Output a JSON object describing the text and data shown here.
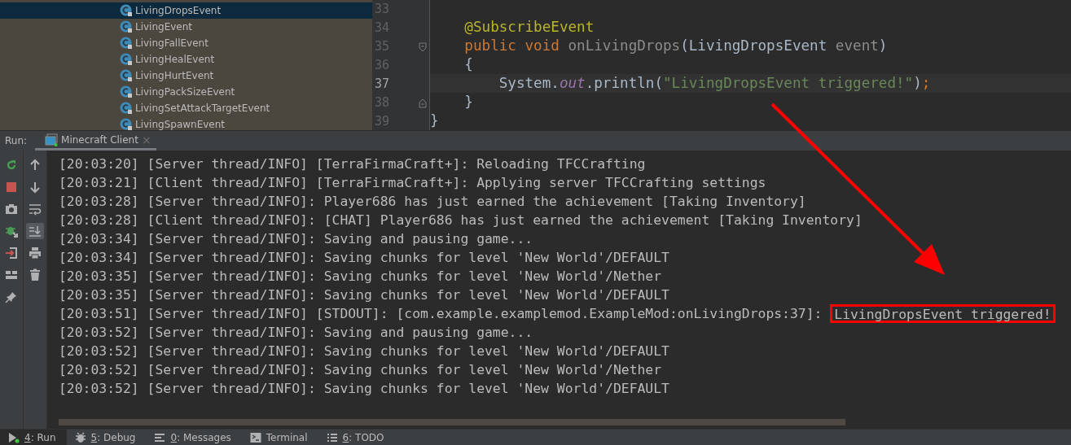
{
  "project_tree": {
    "items": [
      {
        "label": "LivingDropsEvent",
        "selected": true
      },
      {
        "label": "LivingEvent",
        "selected": false
      },
      {
        "label": "LivingFallEvent",
        "selected": false
      },
      {
        "label": "LivingHealEvent",
        "selected": false
      },
      {
        "label": "LivingHurtEvent",
        "selected": false
      },
      {
        "label": "LivingPackSizeEvent",
        "selected": false
      },
      {
        "label": "LivingSetAttackTargetEvent",
        "selected": false
      },
      {
        "label": "LivingSpawnEvent",
        "selected": false
      }
    ]
  },
  "editor": {
    "lines": [
      {
        "number": "33",
        "current": false
      },
      {
        "number": "34",
        "current": false,
        "tokens": [
          {
            "kind": "annotation",
            "text": "    @SubscribeEvent"
          }
        ]
      },
      {
        "number": "35",
        "current": false,
        "fold_start": true,
        "tokens": [
          {
            "kind": "keyword",
            "text": "    public void "
          },
          {
            "kind": "unused",
            "text": "onLivingDrops"
          },
          {
            "kind": "plain",
            "text": "(LivingDropsEvent "
          },
          {
            "kind": "unused",
            "text": "event"
          },
          {
            "kind": "plain",
            "text": ")"
          }
        ]
      },
      {
        "number": "36",
        "current": false,
        "tokens": [
          {
            "kind": "plain",
            "text": "    {"
          }
        ]
      },
      {
        "number": "37",
        "current": true,
        "tokens": [
          {
            "kind": "plain",
            "text": "        System."
          },
          {
            "kind": "static",
            "text": "out"
          },
          {
            "kind": "plain",
            "text": ".println("
          },
          {
            "kind": "string",
            "text": "\"LivingDropsEvent triggered!\""
          },
          {
            "kind": "plain",
            "text": ")"
          },
          {
            "kind": "keyword",
            "text": ";"
          }
        ]
      },
      {
        "number": "38",
        "current": false,
        "fold_end": true,
        "tokens": [
          {
            "kind": "plain",
            "text": "    }"
          }
        ]
      },
      {
        "number": "39",
        "current": false,
        "tokens": [
          {
            "kind": "plain",
            "text": "}"
          }
        ]
      }
    ]
  },
  "run_bar": {
    "label": "Run:",
    "tab": {
      "label": "Minecraft Client",
      "close": "×",
      "selected": true
    }
  },
  "console_toolbar": [
    {
      "kind": "rerun",
      "selected": false
    },
    {
      "kind": "stop",
      "selected": false
    },
    {
      "kind": "camera",
      "selected": false
    },
    {
      "kind": "debug",
      "selected": false
    },
    {
      "kind": "exit",
      "selected": false
    },
    {
      "kind": "layout",
      "selected": false
    },
    {
      "kind": "pin",
      "selected": false
    }
  ],
  "console_toolbar_2": [
    {
      "kind": "up",
      "selected": false
    },
    {
      "kind": "down",
      "selected": false
    },
    {
      "kind": "wrap",
      "selected": false
    },
    {
      "kind": "scroll-end",
      "selected": true
    },
    {
      "kind": "print",
      "selected": false
    },
    {
      "kind": "trash",
      "selected": false
    }
  ],
  "console": {
    "lines": [
      {
        "text": "[20:03:20] [Server thread/INFO] [TerraFirmaCraft+]: Reloading TFCCrafting"
      },
      {
        "text": "[20:03:21] [Client thread/INFO] [TerraFirmaCraft+]: Applying server TFCCrafting settings"
      },
      {
        "text": "[20:03:28] [Server thread/INFO]: Player686 has just earned the achievement [Taking Inventory]"
      },
      {
        "text": "[20:03:28] [Client thread/INFO]: [CHAT] Player686 has just earned the achievement [Taking Inventory]"
      },
      {
        "text": "[20:03:34] [Server thread/INFO]: Saving and pausing game..."
      },
      {
        "text": "[20:03:34] [Server thread/INFO]: Saving chunks for level 'New World'/DEFAULT"
      },
      {
        "text": "[20:03:35] [Server thread/INFO]: Saving chunks for level 'New World'/Nether"
      },
      {
        "text": "[20:03:35] [Server thread/INFO]: Saving chunks for level 'New World'/DEFAULT"
      },
      {
        "text": "[20:03:51] [Server thread/INFO] [STDOUT]: [com.example.examplemod.ExampleMod:onLivingDrops:37]:",
        "boxed": "LivingDropsEvent triggered!"
      },
      {
        "text": "[20:03:52] [Server thread/INFO]: Saving and pausing game..."
      },
      {
        "text": "[20:03:52] [Server thread/INFO]: Saving chunks for level 'New World'/DEFAULT"
      },
      {
        "text": "[20:03:52] [Server thread/INFO]: Saving chunks for level 'New World'/Nether"
      },
      {
        "text": "[20:03:52] [Server thread/INFO]: Saving chunks for level 'New World'/DEFAULT"
      }
    ]
  },
  "bottom_tabs": [
    {
      "kind": "run",
      "key": "4",
      "label": ": Run",
      "selected": true
    },
    {
      "kind": "debug",
      "key": "5",
      "label": ": Debug",
      "selected": false
    },
    {
      "kind": "messages",
      "key": "0",
      "label": ": Messages",
      "selected": false
    },
    {
      "kind": "terminal",
      "label": "Terminal",
      "selected": false
    },
    {
      "kind": "todo",
      "key": "6",
      "label": ": TODO",
      "selected": false
    }
  ]
}
